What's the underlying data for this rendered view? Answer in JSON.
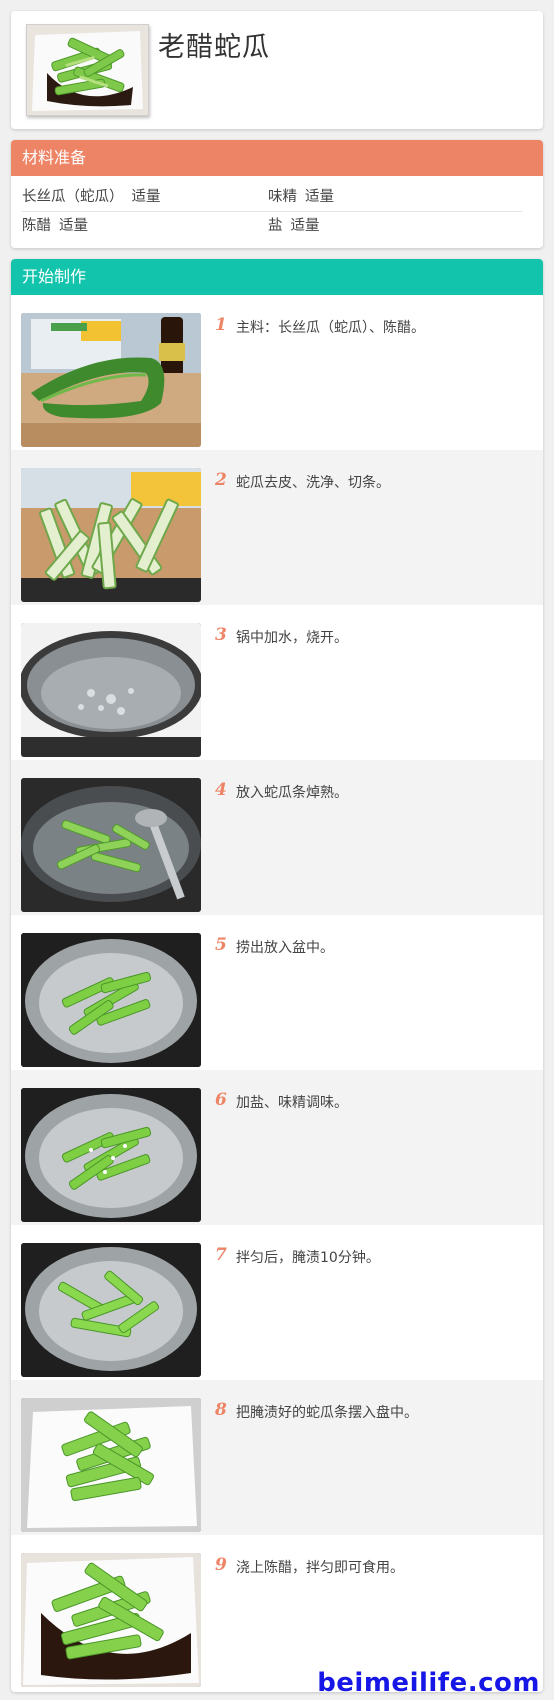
{
  "recipe": {
    "title": "老醋蛇瓜"
  },
  "ingredients": {
    "heading": "材料准备",
    "rows": [
      [
        {
          "name": "长丝瓜（蛇瓜）",
          "amount": "适量"
        },
        {
          "name": "味精",
          "amount": "适量"
        }
      ],
      [
        {
          "name": "陈醋",
          "amount": "适量"
        },
        {
          "name": "盐",
          "amount": "适量"
        }
      ]
    ]
  },
  "steps": {
    "heading": "开始制作",
    "items": [
      {
        "num": "1",
        "text": "主料：长丝瓜（蛇瓜）、陈醋。"
      },
      {
        "num": "2",
        "text": "蛇瓜去皮、洗净、切条。"
      },
      {
        "num": "3",
        "text": "锅中加水，烧开。"
      },
      {
        "num": "4",
        "text": "放入蛇瓜条焯熟。"
      },
      {
        "num": "5",
        "text": "捞出放入盆中。"
      },
      {
        "num": "6",
        "text": "加盐、味精调味。"
      },
      {
        "num": "7",
        "text": "拌匀后，腌渍10分钟。"
      },
      {
        "num": "8",
        "text": "把腌渍好的蛇瓜条摆入盘中。"
      },
      {
        "num": "9",
        "text": "浇上陈醋，拌匀即可食用。"
      }
    ]
  },
  "watermark": "beimeilife.com",
  "colors": {
    "ingredients_header": "#ee8466",
    "steps_header": "#13c4ad",
    "step_number": "#ee8466",
    "watermark": "#1616e6"
  },
  "icons": {
    "photos": [
      "finished-dish-photo",
      "raw-snake-gourd-photo",
      "cut-strips-photo",
      "boiling-water-photo",
      "blanching-photo",
      "bowl-strips-photo",
      "seasoning-photo",
      "marinating-photo",
      "plated-strips-photo",
      "vinegar-dish-photo"
    ]
  }
}
